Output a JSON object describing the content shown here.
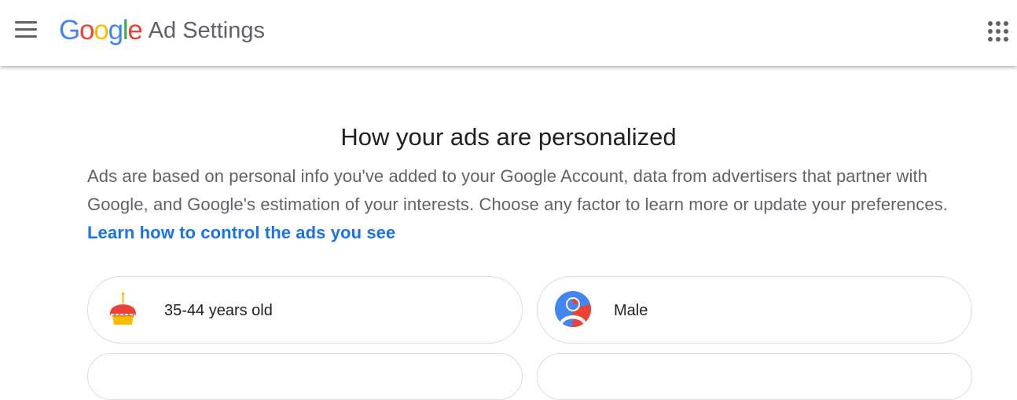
{
  "header": {
    "logo_letters": [
      {
        "char": "G",
        "color": "#4285F4"
      },
      {
        "char": "o",
        "color": "#EA4335"
      },
      {
        "char": "o",
        "color": "#FBBC05"
      },
      {
        "char": "g",
        "color": "#4285F4"
      },
      {
        "char": "l",
        "color": "#34A853"
      },
      {
        "char": "e",
        "color": "#EA4335"
      }
    ],
    "product_name": "Ad Settings",
    "menu_icon": "hamburger-menu-icon",
    "apps_icon": "apps-grid-icon"
  },
  "main": {
    "title": "How your ads are personalized",
    "intro_text": "Ads are based on personal info you've added to your Google Account, data from advertisers that partner with Google, and Google's estimation of your interests. Choose any factor to learn more or update your preferences. ",
    "intro_link": "Learn how to control the ads you see",
    "link_color": "#1a73e8",
    "factors": [
      {
        "label": "35-44 years old",
        "icon": "birthday-cake-icon"
      },
      {
        "label": "Male",
        "icon": "person-avatar-icon"
      }
    ]
  }
}
